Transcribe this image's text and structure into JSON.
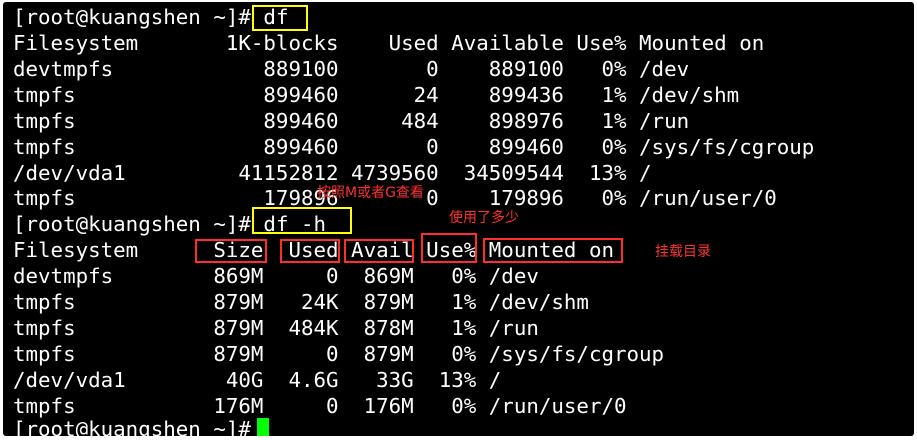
{
  "prompt": "[root@kuangshen ~]# ",
  "commands": {
    "df": "df",
    "df_h": "df -h"
  },
  "df": {
    "header": "Filesystem       1K-blocks    Used Available Use% Mounted on",
    "rows": [
      "devtmpfs            889100       0    889100   0% /dev",
      "tmpfs               899460      24    899436   1% /dev/shm",
      "tmpfs               899460     484    898976   1% /run",
      "tmpfs               899460       0    899460   0% /sys/fs/cgroup",
      "/dev/vda1         41152812 4739560  34509544  13% /",
      "tmpfs               179896       0    179896   0% /run/user/0"
    ]
  },
  "df_h": {
    "header": "Filesystem      Size  Used Avail Use% Mounted on",
    "rows": [
      "devtmpfs        869M     0  869M   0% /dev",
      "tmpfs           879M   24K  879M   1% /dev/shm",
      "tmpfs           879M  484K  878M   1% /run",
      "tmpfs           879M     0  879M   0% /sys/fs/cgroup",
      "/dev/vda1        40G  4.6G   33G  13% /",
      "tmpfs           176M     0  176M   0% /run/user/0"
    ]
  },
  "annotations": {
    "view_by_mg": "按照M或者G查看",
    "how_much_used": "使用了多少",
    "mount_dir": "挂载目录"
  },
  "colors": {
    "background": "#000000",
    "text": "#ffffff",
    "cursor": "#00ff00",
    "highlight_yellow": "#ffff00",
    "highlight_red": "#ff2d2d"
  }
}
